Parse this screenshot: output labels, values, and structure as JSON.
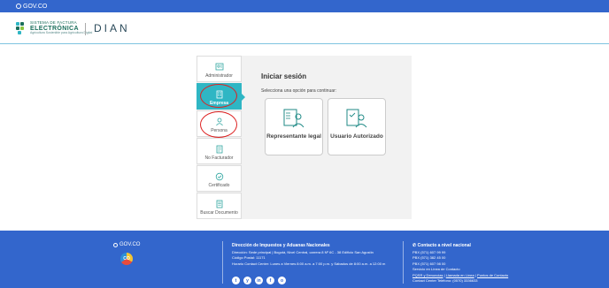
{
  "gov_bar": {
    "label": "GOV.CO"
  },
  "header": {
    "brand_line1": "SISTEMA DE FACTURA",
    "brand_line2": "ELECTRÓNICA",
    "brand_line3": "Agricultura Sostenible para Agricultura Digital",
    "dian": "DIAN"
  },
  "sidebar": {
    "items": [
      {
        "label": "Administrador"
      },
      {
        "label": "Empresa"
      },
      {
        "label": "Persona"
      },
      {
        "label": "No Facturador"
      },
      {
        "label": "Certificado"
      },
      {
        "label": "Buscar Documento"
      }
    ]
  },
  "login": {
    "title": "Iniciar sesión",
    "subtitle": "Selecciona una opción para continuar:",
    "options": [
      {
        "label": "Representante legal"
      },
      {
        "label": "Usuario Autorizado"
      }
    ]
  },
  "footer": {
    "govco": "GOV.CO",
    "co": "CO",
    "entity_title": "Dirección de Impuestos y Aduanas Nacionales",
    "address": "Dirección: Sede principal | Bogotá, Nivel Central, carrera 8 Nº 6C - 38 Edificio San Agustín",
    "postal": "Código Postal: 11171",
    "hours": "Horario Contact Center: Lunes a Viernes 8:00 a.m. a 7:00 p.m. y Sábados de 8:00 a.m. a 12:00 m",
    "contact_title": "Contacto a nivel nacional",
    "phone1": "PBX (571) 607 99 99",
    "phone2": "PBX (571) 382 45 00",
    "phone3": "PBX (571) 607 98 00",
    "online": "Servicio en Línea de Contacto",
    "pqsr": "PQSR y Denuncias",
    "callback": "Llamada en Línea",
    "points": "Puntos de Contacto",
    "center": "Contact Center Teléfono: (0570) 3336633",
    "socials": [
      "t",
      "y",
      "in",
      "f",
      "o"
    ]
  }
}
